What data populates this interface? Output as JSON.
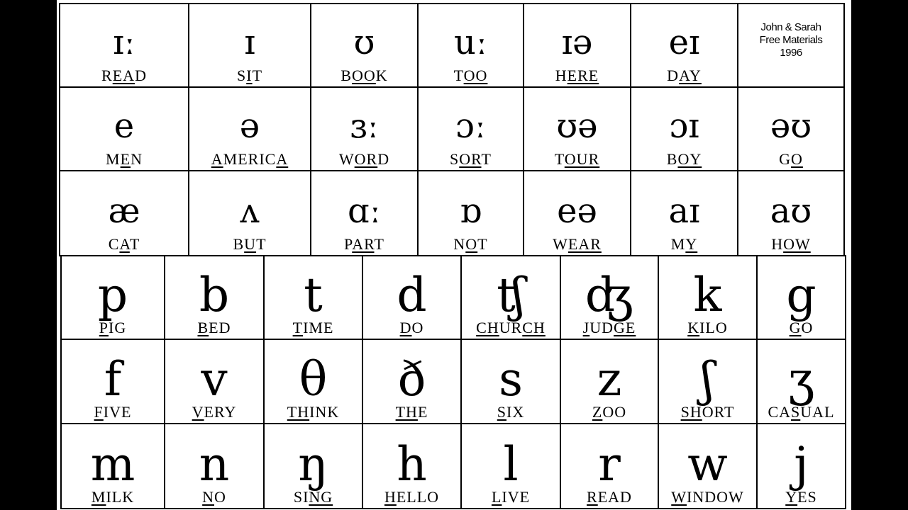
{
  "credit": {
    "line1": "John & Sarah",
    "line2": "Free Materials",
    "line3": "1996"
  },
  "vowels": [
    [
      {
        "symbol": "ɪː",
        "word": [
          {
            "t": "R"
          },
          {
            "t": "EA",
            "u": true
          },
          {
            "t": "D"
          }
        ]
      },
      {
        "symbol": "ɪ",
        "word": [
          {
            "t": "S"
          },
          {
            "t": "I",
            "u": true
          },
          {
            "t": "T"
          }
        ]
      },
      {
        "symbol": "ʊ",
        "word": [
          {
            "t": "B"
          },
          {
            "t": "OO",
            "u": true
          },
          {
            "t": "K"
          }
        ]
      },
      {
        "symbol": "uː",
        "word": [
          {
            "t": "T"
          },
          {
            "t": "OO",
            "u": true
          }
        ]
      },
      {
        "symbol": "ɪə",
        "word": [
          {
            "t": "H"
          },
          {
            "t": "ERE",
            "u": true
          }
        ]
      },
      {
        "symbol": "eɪ",
        "word": [
          {
            "t": "D"
          },
          {
            "t": "AY",
            "u": true
          }
        ]
      }
    ],
    [
      {
        "symbol": "e",
        "word": [
          {
            "t": "M"
          },
          {
            "t": "E",
            "u": true
          },
          {
            "t": "N"
          }
        ]
      },
      {
        "symbol": "ə",
        "word": [
          {
            "t": "A",
            "u": true
          },
          {
            "t": "MERIC"
          },
          {
            "t": "A",
            "u": true
          }
        ]
      },
      {
        "symbol": "ɜː",
        "word": [
          {
            "t": "W"
          },
          {
            "t": "OR",
            "u": true
          },
          {
            "t": "D"
          }
        ]
      },
      {
        "symbol": "ɔː",
        "word": [
          {
            "t": "S"
          },
          {
            "t": "OR",
            "u": true
          },
          {
            "t": "T"
          }
        ]
      },
      {
        "symbol": "ʊə",
        "word": [
          {
            "t": "T"
          },
          {
            "t": "OUR",
            "u": true
          }
        ]
      },
      {
        "symbol": "ɔɪ",
        "word": [
          {
            "t": "B"
          },
          {
            "t": "OY",
            "u": true
          }
        ]
      },
      {
        "symbol": "əʊ",
        "word": [
          {
            "t": "G"
          },
          {
            "t": "O",
            "u": true
          }
        ]
      }
    ],
    [
      {
        "symbol": "æ",
        "word": [
          {
            "t": "C"
          },
          {
            "t": "A",
            "u": true
          },
          {
            "t": "T"
          }
        ]
      },
      {
        "symbol": "ʌ",
        "word": [
          {
            "t": "B"
          },
          {
            "t": "U",
            "u": true
          },
          {
            "t": "T"
          }
        ]
      },
      {
        "symbol": "ɑː",
        "word": [
          {
            "t": "P"
          },
          {
            "t": "AR",
            "u": true
          },
          {
            "t": "T"
          }
        ]
      },
      {
        "symbol": "ɒ",
        "word": [
          {
            "t": "N"
          },
          {
            "t": "O",
            "u": true
          },
          {
            "t": "T"
          }
        ]
      },
      {
        "symbol": "eə",
        "word": [
          {
            "t": "W"
          },
          {
            "t": "EAR",
            "u": true
          }
        ]
      },
      {
        "symbol": "aɪ",
        "word": [
          {
            "t": "M"
          },
          {
            "t": "Y",
            "u": true
          }
        ]
      },
      {
        "symbol": "aʊ",
        "word": [
          {
            "t": "H"
          },
          {
            "t": "OW",
            "u": true
          }
        ]
      }
    ]
  ],
  "consonants": [
    [
      {
        "symbol": "p",
        "word": [
          {
            "t": "P",
            "u": true
          },
          {
            "t": "IG"
          }
        ]
      },
      {
        "symbol": "b",
        "word": [
          {
            "t": "B",
            "u": true
          },
          {
            "t": "ED"
          }
        ]
      },
      {
        "symbol": "t",
        "word": [
          {
            "t": "T",
            "u": true
          },
          {
            "t": "IME"
          }
        ]
      },
      {
        "symbol": "d",
        "word": [
          {
            "t": "D",
            "u": true
          },
          {
            "t": "O"
          }
        ]
      },
      {
        "symbol": "ʧ",
        "word": [
          {
            "t": "CH",
            "u": true
          },
          {
            "t": "UR"
          },
          {
            "t": "CH",
            "u": true
          }
        ]
      },
      {
        "symbol": "ʤ",
        "word": [
          {
            "t": "J",
            "u": true
          },
          {
            "t": "UD"
          },
          {
            "t": "GE",
            "u": true
          }
        ]
      },
      {
        "symbol": "k",
        "word": [
          {
            "t": "K",
            "u": true
          },
          {
            "t": "ILO"
          }
        ]
      },
      {
        "symbol": "g",
        "word": [
          {
            "t": "G",
            "u": true
          },
          {
            "t": "O"
          }
        ]
      }
    ],
    [
      {
        "symbol": "f",
        "word": [
          {
            "t": "F",
            "u": true
          },
          {
            "t": "IVE"
          }
        ]
      },
      {
        "symbol": "v",
        "word": [
          {
            "t": "V",
            "u": true
          },
          {
            "t": "ERY"
          }
        ]
      },
      {
        "symbol": "θ",
        "word": [
          {
            "t": "TH",
            "u": true
          },
          {
            "t": "INK"
          }
        ]
      },
      {
        "symbol": "ð",
        "word": [
          {
            "t": "TH",
            "u": true
          },
          {
            "t": "E"
          }
        ]
      },
      {
        "symbol": "s",
        "word": [
          {
            "t": "S",
            "u": true
          },
          {
            "t": "IX"
          }
        ]
      },
      {
        "symbol": "z",
        "word": [
          {
            "t": "Z",
            "u": true
          },
          {
            "t": "OO"
          }
        ]
      },
      {
        "symbol": "ʃ",
        "word": [
          {
            "t": "SH",
            "u": true
          },
          {
            "t": "ORT"
          }
        ]
      },
      {
        "symbol": "ʒ",
        "word": [
          {
            "t": "CA"
          },
          {
            "t": "S",
            "u": true
          },
          {
            "t": "UAL"
          }
        ]
      }
    ],
    [
      {
        "symbol": "m",
        "word": [
          {
            "t": "M",
            "u": true
          },
          {
            "t": "ILK"
          }
        ]
      },
      {
        "symbol": "n",
        "word": [
          {
            "t": "N",
            "u": true
          },
          {
            "t": "O"
          }
        ]
      },
      {
        "symbol": "ŋ",
        "word": [
          {
            "t": "SI"
          },
          {
            "t": "NG",
            "u": true
          }
        ]
      },
      {
        "symbol": "h",
        "word": [
          {
            "t": "H",
            "u": true
          },
          {
            "t": "ELLO"
          }
        ]
      },
      {
        "symbol": "l",
        "word": [
          {
            "t": "L",
            "u": true
          },
          {
            "t": "IVE"
          }
        ]
      },
      {
        "symbol": "r",
        "word": [
          {
            "t": "R",
            "u": true
          },
          {
            "t": "EAD"
          }
        ]
      },
      {
        "symbol": "w",
        "word": [
          {
            "t": "W",
            "u": true
          },
          {
            "t": "INDOW"
          }
        ]
      },
      {
        "symbol": "j",
        "word": [
          {
            "t": "Y",
            "u": true
          },
          {
            "t": "ES"
          }
        ]
      }
    ]
  ]
}
